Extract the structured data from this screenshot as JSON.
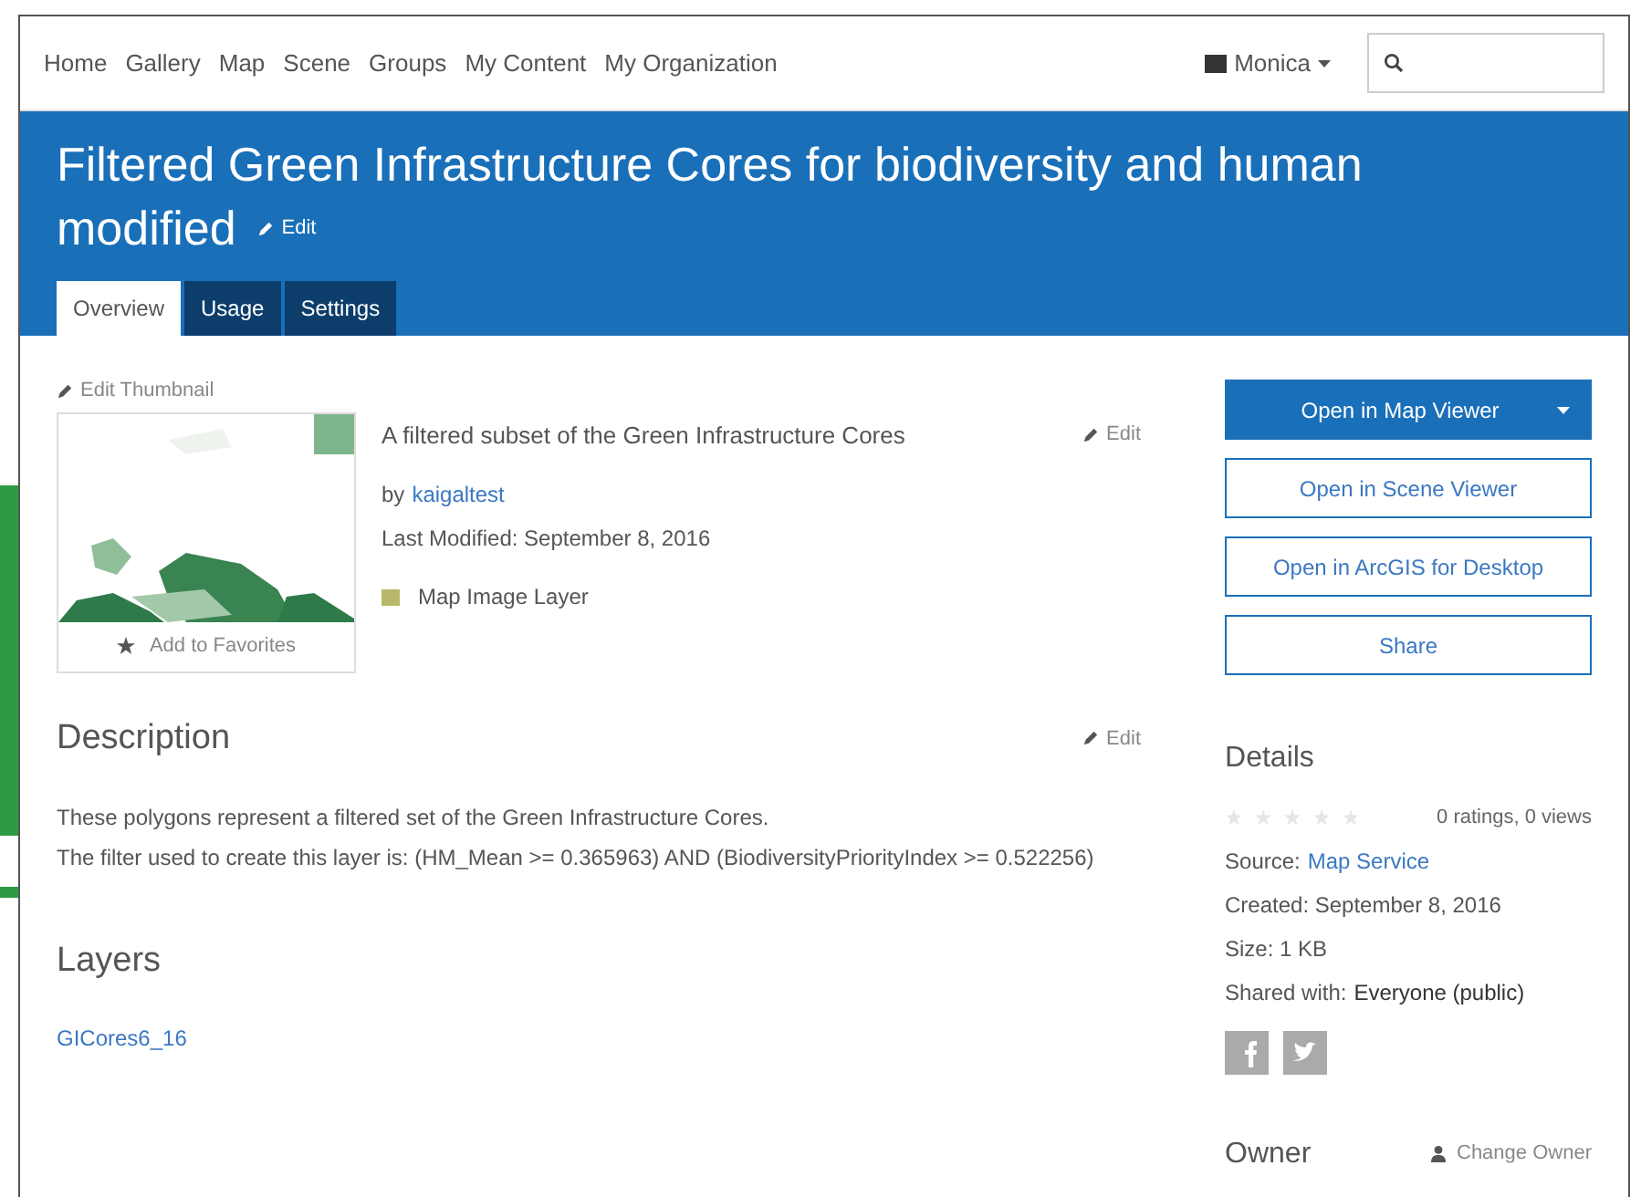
{
  "nav": {
    "links": [
      "Home",
      "Gallery",
      "Map",
      "Scene",
      "Groups",
      "My Content",
      "My Organization"
    ],
    "user": "Monica"
  },
  "header": {
    "title_lines": [
      "Filtered Green Infrastructure Cores for biodiversity and human",
      "modified"
    ],
    "edit": "Edit"
  },
  "tabs": [
    {
      "label": "Overview",
      "selected": true
    },
    {
      "label": "Usage",
      "selected": false
    },
    {
      "label": "Settings",
      "selected": false
    }
  ],
  "thumbnail": {
    "edit": "Edit Thumbnail",
    "favorite": "Add to Favorites"
  },
  "summary": {
    "text": "A filtered subset of the Green Infrastructure Cores",
    "edit": "Edit",
    "by": "by",
    "owner": "kaigaltest",
    "modified": "Last Modified: September 8, 2016",
    "type": "Map Image Layer"
  },
  "description": {
    "heading": "Description",
    "edit": "Edit",
    "lines": [
      "These polygons represent a filtered set of the Green Infrastructure Cores.",
      "The filter used to create this layer is: (HM_Mean >= 0.365963) AND (BiodiversityPriorityIndex >= 0.522256)"
    ]
  },
  "layers": {
    "heading": "Layers",
    "items": [
      "GICores6_16"
    ]
  },
  "actions": [
    {
      "label": "Open in Map Viewer",
      "kind": "primary"
    },
    {
      "label": "Open in Scene Viewer",
      "kind": "outline"
    },
    {
      "label": "Open in ArcGIS for Desktop",
      "kind": "outline"
    },
    {
      "label": "Share",
      "kind": "outline"
    }
  ],
  "details": {
    "heading": "Details",
    "stars": 0,
    "counts": "0 ratings, 0 views",
    "source_label": "Source:",
    "source": "Map Service",
    "created": "Created: September 8, 2016",
    "size": "Size: 1 KB",
    "shared_label": "Shared with:",
    "shared": "Everyone (public)"
  },
  "owner": {
    "heading": "Owner",
    "change": "Change Owner"
  }
}
